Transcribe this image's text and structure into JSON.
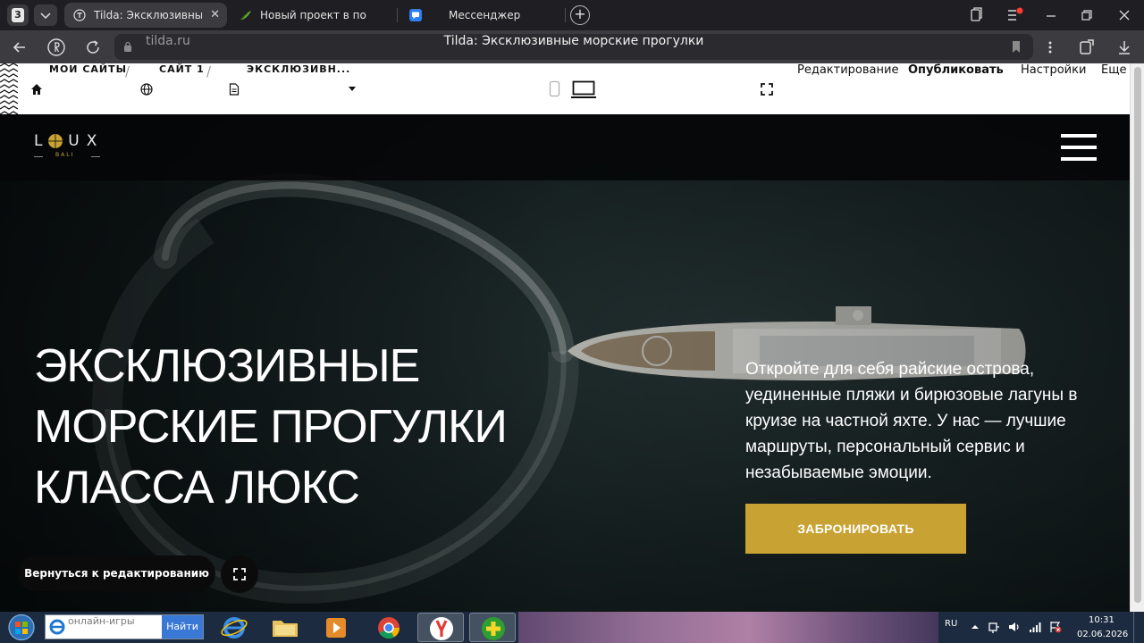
{
  "browser": {
    "tab_count": "3",
    "tabs": [
      {
        "title": "Tilda: Эксклюзивные м",
        "active": true
      },
      {
        "title": "Новый проект в портфол",
        "active": false
      },
      {
        "title": "Мессенджер",
        "active": false
      }
    ],
    "url_host": "tilda.ru",
    "page_title": "Tilda: Эксклюзивные морские прогулки"
  },
  "tilda_bar": {
    "breadcrumbs": [
      "МОИ САЙТЫ",
      "САЙТ 1",
      "ЭКСКЛЮЗИВН..."
    ],
    "separator": "/",
    "actions": {
      "edit": "Редактирование",
      "publish": "Опубликовать",
      "settings": "Настройки",
      "more": "Еще"
    }
  },
  "site": {
    "logo": "LOUX",
    "logo_sub": "BALI",
    "hero_title_lines": [
      "ЭКСКЛЮЗИВНЫЕ",
      "МОРСКИЕ ПРОГУЛКИ",
      "КЛАССА ЛЮКС"
    ],
    "hero_text": "Откройте для себя райские острова, уединенные пляжи и бирюзовые лагуны в круизе на частной яхте. У нас — лучшие маршруты, персональный сервис и незабываемые эмоции.",
    "cta_label": "ЗАБРОНИРОВАТЬ",
    "back_to_edit_label": "Вернуться к редактированию",
    "accent_color": "#c9a234"
  },
  "taskbar": {
    "search_placeholder": "онлайн-игры",
    "search_button": "Найти",
    "language": "RU",
    "time": "10:31",
    "date": "02.06.2026"
  }
}
